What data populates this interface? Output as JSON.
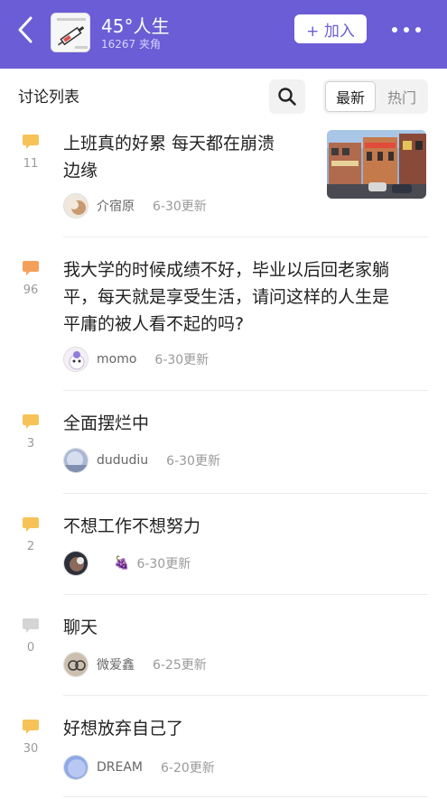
{
  "header": {
    "group_name": "45°人生",
    "group_meta": "16267 夹角",
    "join_label": "+ 加入",
    "bg_color": "#6a5dd6"
  },
  "toolbar": {
    "list_title": "讨论列表",
    "sort_new": "最新",
    "sort_hot": "热门",
    "search_icon": "search-icon"
  },
  "posts": [
    {
      "count": "11",
      "title_lines": [
        "上班真的好累 每天都在崩溃",
        "边缘"
      ],
      "author": "介宿原",
      "time": "6-30更新",
      "bubble_color": "#f7c358",
      "has_thumbnail": true
    },
    {
      "count": "96",
      "title_lines": [
        "我大学的时候成绩不好，毕业以后回老家躺",
        "平，每天就是享受生活，请问这样的人生是",
        "平庸的被人看不起的吗?"
      ],
      "author": "momo",
      "time": "6-30更新",
      "bubble_color": "#f5a05a",
      "has_thumbnail": false
    },
    {
      "count": "3",
      "title_lines": [
        "全面摆烂中"
      ],
      "author": "dududiu",
      "time": "6-30更新",
      "bubble_color": "#f7c358",
      "has_thumbnail": false
    },
    {
      "count": "2",
      "title_lines": [
        "不想工作不想努力"
      ],
      "author": "🍇",
      "time": "6-30更新",
      "bubble_color": "#f7c358",
      "has_thumbnail": false
    },
    {
      "count": "0",
      "title_lines": [
        "聊天"
      ],
      "author": "微爱鑫",
      "time": "6-25更新",
      "bubble_color": "#d5d5d5",
      "has_thumbnail": false
    },
    {
      "count": "30",
      "title_lines": [
        "好想放弃自己了"
      ],
      "author": "DREAM",
      "time": "6-20更新",
      "bubble_color": "#f7c358",
      "has_thumbnail": false
    }
  ]
}
